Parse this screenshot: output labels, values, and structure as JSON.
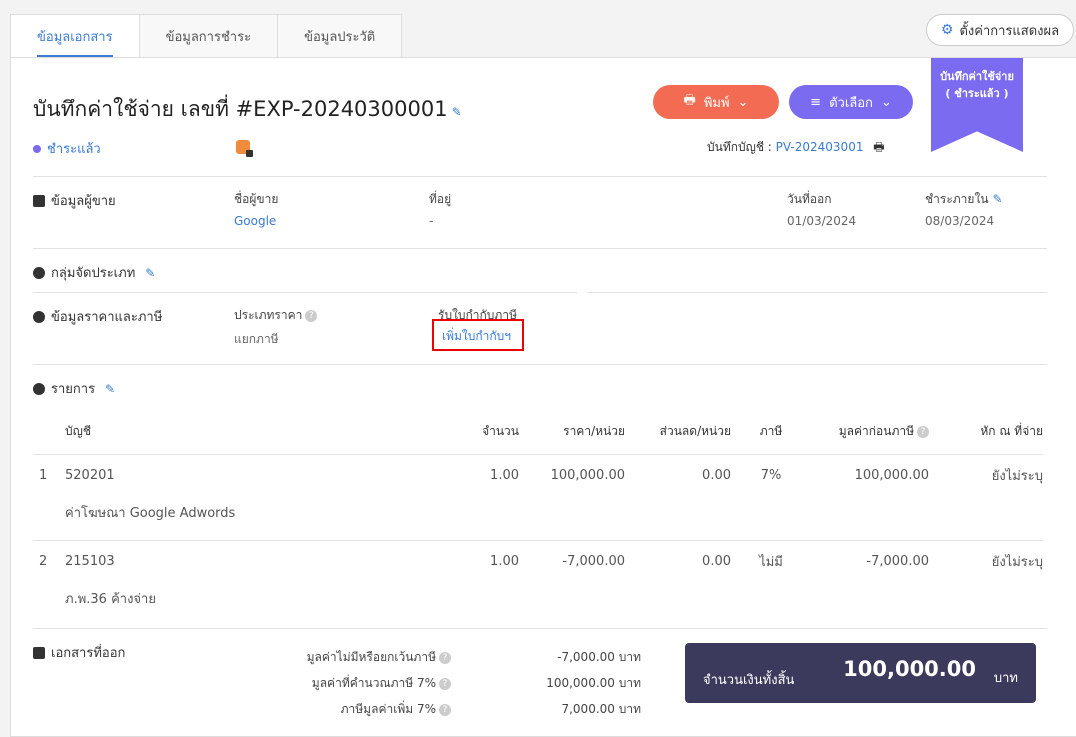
{
  "tabs": [
    {
      "label": "ข้อมูลเอกสาร"
    },
    {
      "label": "ข้อมูลการชำระ"
    },
    {
      "label": "ข้อมูลประวัติ"
    }
  ],
  "settings_label": "ตั้งค่าการแสดงผล",
  "header": {
    "title": "บันทึกค่าใช้จ่าย เลขที่ #EXP-20240300001",
    "print_label": "พิมพ์",
    "options_label": "ตัวเลือก",
    "ribbon_line1": "บันทึกค่าใช้จ่าย",
    "ribbon_line2": "( ชำระแล้ว )",
    "status": "ชำระแล้ว",
    "journal_label": "บันทึกบัญชี :",
    "journal_no": "PV-202403001"
  },
  "vendor": {
    "section": "ข้อมูลผู้ขาย",
    "name_label": "ชื่อผู้ขาย",
    "name": "Google",
    "address_label": "ที่อยู่",
    "address": "-",
    "issue_label": "วันที่ออก",
    "issue_date": "01/03/2024",
    "due_label": "ชำระภายใน",
    "due_date": "08/03/2024"
  },
  "category_section": "กลุ่มจัดประเภท",
  "tax": {
    "section": "ข้อมูลราคาและภาษี",
    "price_type_label": "ประเภทราคา",
    "price_type": "แยกภาษี",
    "tax_invoice_label": "รับใบกำกับภาษี",
    "add_tax_invoice": "เพิ่มใบกำกับฯ"
  },
  "items": {
    "section": "รายการ",
    "columns": [
      "บัญชี",
      "จำนวน",
      "ราคา/หน่วย",
      "ส่วนลด/หน่วย",
      "ภาษี",
      "มูลค่าก่อนภาษี",
      "หัก ณ ที่จ่าย"
    ],
    "rows": [
      {
        "no": "1",
        "account": "520201",
        "desc": "ค่าโฆษณา Google Adwords",
        "qty": "1.00",
        "price": "100,000.00",
        "discount": "0.00",
        "vat": "7%",
        "pre_tax": "100,000.00",
        "wht": "ยังไม่ระบุ"
      },
      {
        "no": "2",
        "account": "215103",
        "desc": "ภ.พ.36 ค้างจ่าย",
        "qty": "1.00",
        "price": "-7,000.00",
        "discount": "0.00",
        "vat": "ไม่มี",
        "pre_tax": "-7,000.00",
        "wht": "ยังไม่ระบุ"
      }
    ]
  },
  "summary": {
    "section": "เอกสารที่ออก",
    "non_vat_label": "มูลค่าไม่มีหรือยกเว้นภาษี",
    "non_vat": "-7,000.00 บาท",
    "vat_base_label": "มูลค่าที่คำนวณภาษี 7%",
    "vat_base": "100,000.00 บาท",
    "vat_label": "ภาษีมูลค่าเพิ่ม 7%",
    "vat": "7,000.00 บาท",
    "total_label": "จำนวนเงินทั้งสิ้น",
    "total": "100,000.00",
    "total_unit": "บาท"
  }
}
